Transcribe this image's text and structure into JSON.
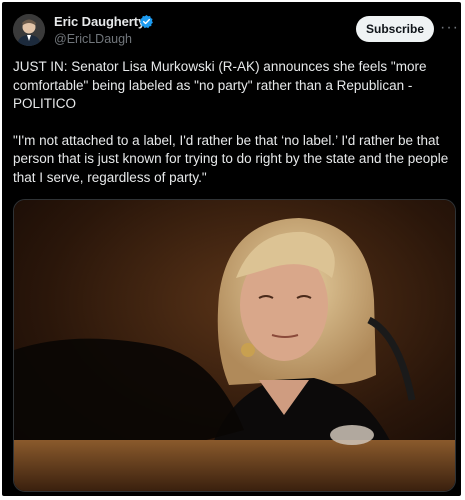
{
  "author": {
    "display_name": "Eric Daugherty",
    "handle": "@EricLDaugh",
    "verified_icon": "verified-badge-icon",
    "badge_color": "#1d9bf0"
  },
  "actions": {
    "subscribe_label": "Subscribe",
    "more_label": "···"
  },
  "tweet": {
    "line1": "JUST IN: Senator Lisa Murkowski (R-AK) announces she feels \"more comfortable\" being labeled as \"no party\" rather than a Republican - POLITICO",
    "quote": "\"I'm not attached to a label, I'd rather be that ‘no label.’ I'd rather be that person that is just known for trying to do right by the state and the people that I serve, regardless of party.\""
  },
  "colors": {
    "background": "#000000",
    "text": "#e7e9ea",
    "secondary": "#71767b"
  }
}
